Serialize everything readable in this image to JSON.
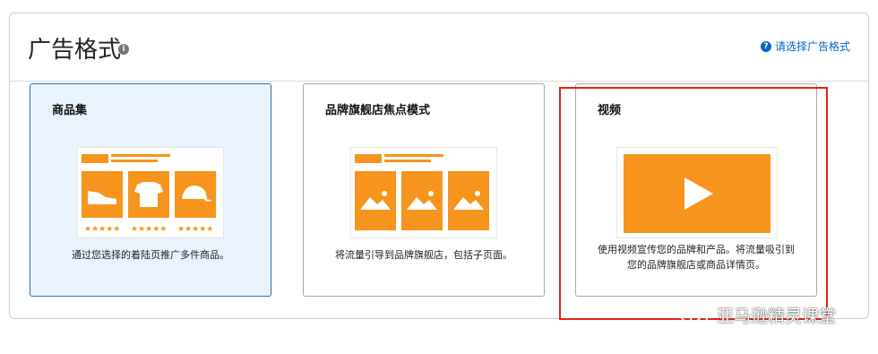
{
  "header": {
    "title": "广告格式",
    "help_text": "请选择广告格式"
  },
  "cards": [
    {
      "title": "商品集",
      "desc": "通过您选择的着陆页推广多件商品。",
      "selected": true
    },
    {
      "title": "品牌旗舰店焦点模式",
      "desc": "将流量引导到品牌旗舰店，包括子页面。",
      "selected": false
    },
    {
      "title": "视频",
      "desc": "使用视频宣传您的品牌和产品。将流量吸引到您的品牌旗舰店或商品详情页。",
      "selected": false
    }
  ],
  "watermark": "亚马逊精灵课堂",
  "colors": {
    "accent_orange": "#f7941d",
    "link_blue": "#0066c0",
    "selected_bg": "#e8f3fd",
    "highlight_red": "#e62117"
  }
}
